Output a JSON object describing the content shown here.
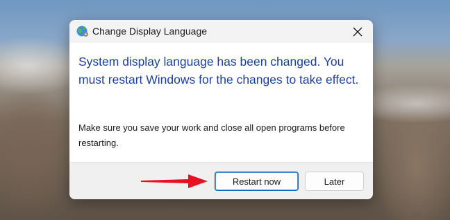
{
  "dialog": {
    "title": "Change Display Language",
    "icon": "globe-settings-icon",
    "close_icon": "close-icon",
    "main_instruction": "System display language has been changed. You must restart Windows for the changes to take effect.",
    "content_text": "Make sure you save your work and close all open programs before restarting.",
    "buttons": {
      "restart_label": "Restart now",
      "later_label": "Later"
    }
  },
  "annotation": {
    "icon": "red-arrow-icon",
    "color": "#e81123"
  },
  "colors": {
    "instruction_text": "#1e3f9c",
    "primary_border": "#0067c0"
  }
}
